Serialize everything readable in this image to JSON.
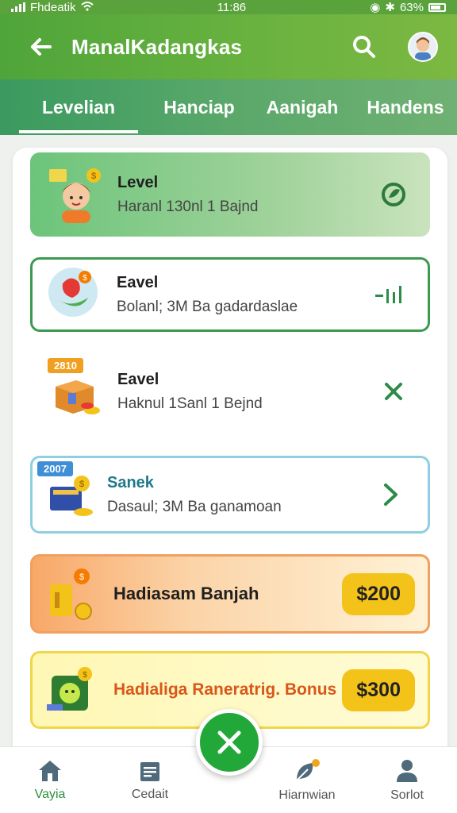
{
  "status_bar": {
    "carrier": "Fhdeatik",
    "time": "11:86",
    "battery": "63%"
  },
  "app_bar": {
    "title": "ManalKadangkas"
  },
  "tabs": [
    {
      "label": "Levelian",
      "active": true
    },
    {
      "label": "Hanciap",
      "active": false
    },
    {
      "label": "Aanigah",
      "active": false
    },
    {
      "label": "Handens",
      "active": false
    }
  ],
  "cards": [
    {
      "title": "Level",
      "subtitle": "Haranl 130nl 1 Bajnd",
      "action_icon": "circle-leaf-icon"
    },
    {
      "title": "Eavel",
      "subtitle": "Bolanl; 3M Ba gadardaslae",
      "action_icon": "bar-chart-icon"
    },
    {
      "tag": "2810",
      "title": "Eavel",
      "subtitle": "Haknul 1Sanl 1 Bejnd",
      "action_icon": "close-icon"
    },
    {
      "tag": "2007",
      "title": "Sanek",
      "subtitle": "Dasaul; 3M Ba ganamoan",
      "action_icon": "chevron-right-icon"
    }
  ],
  "bonus_cards": [
    {
      "title": "Hadiasam Banjah",
      "price": "$200"
    },
    {
      "title": "Hadialiga Raneratrig. Bonus",
      "price": "$300"
    }
  ],
  "bottom_nav": [
    {
      "label": "Vayia",
      "icon": "home-icon",
      "active": true
    },
    {
      "label": "Cedait",
      "icon": "list-icon",
      "active": false
    },
    {
      "label": "Hiarnwian",
      "icon": "leaf-icon",
      "active": false
    },
    {
      "label": "Sorlot",
      "icon": "person-icon",
      "active": false
    }
  ],
  "colors": {
    "primary_green": "#4fa53a",
    "accent_gold": "#f4c31a",
    "fab_green": "#22a838"
  }
}
